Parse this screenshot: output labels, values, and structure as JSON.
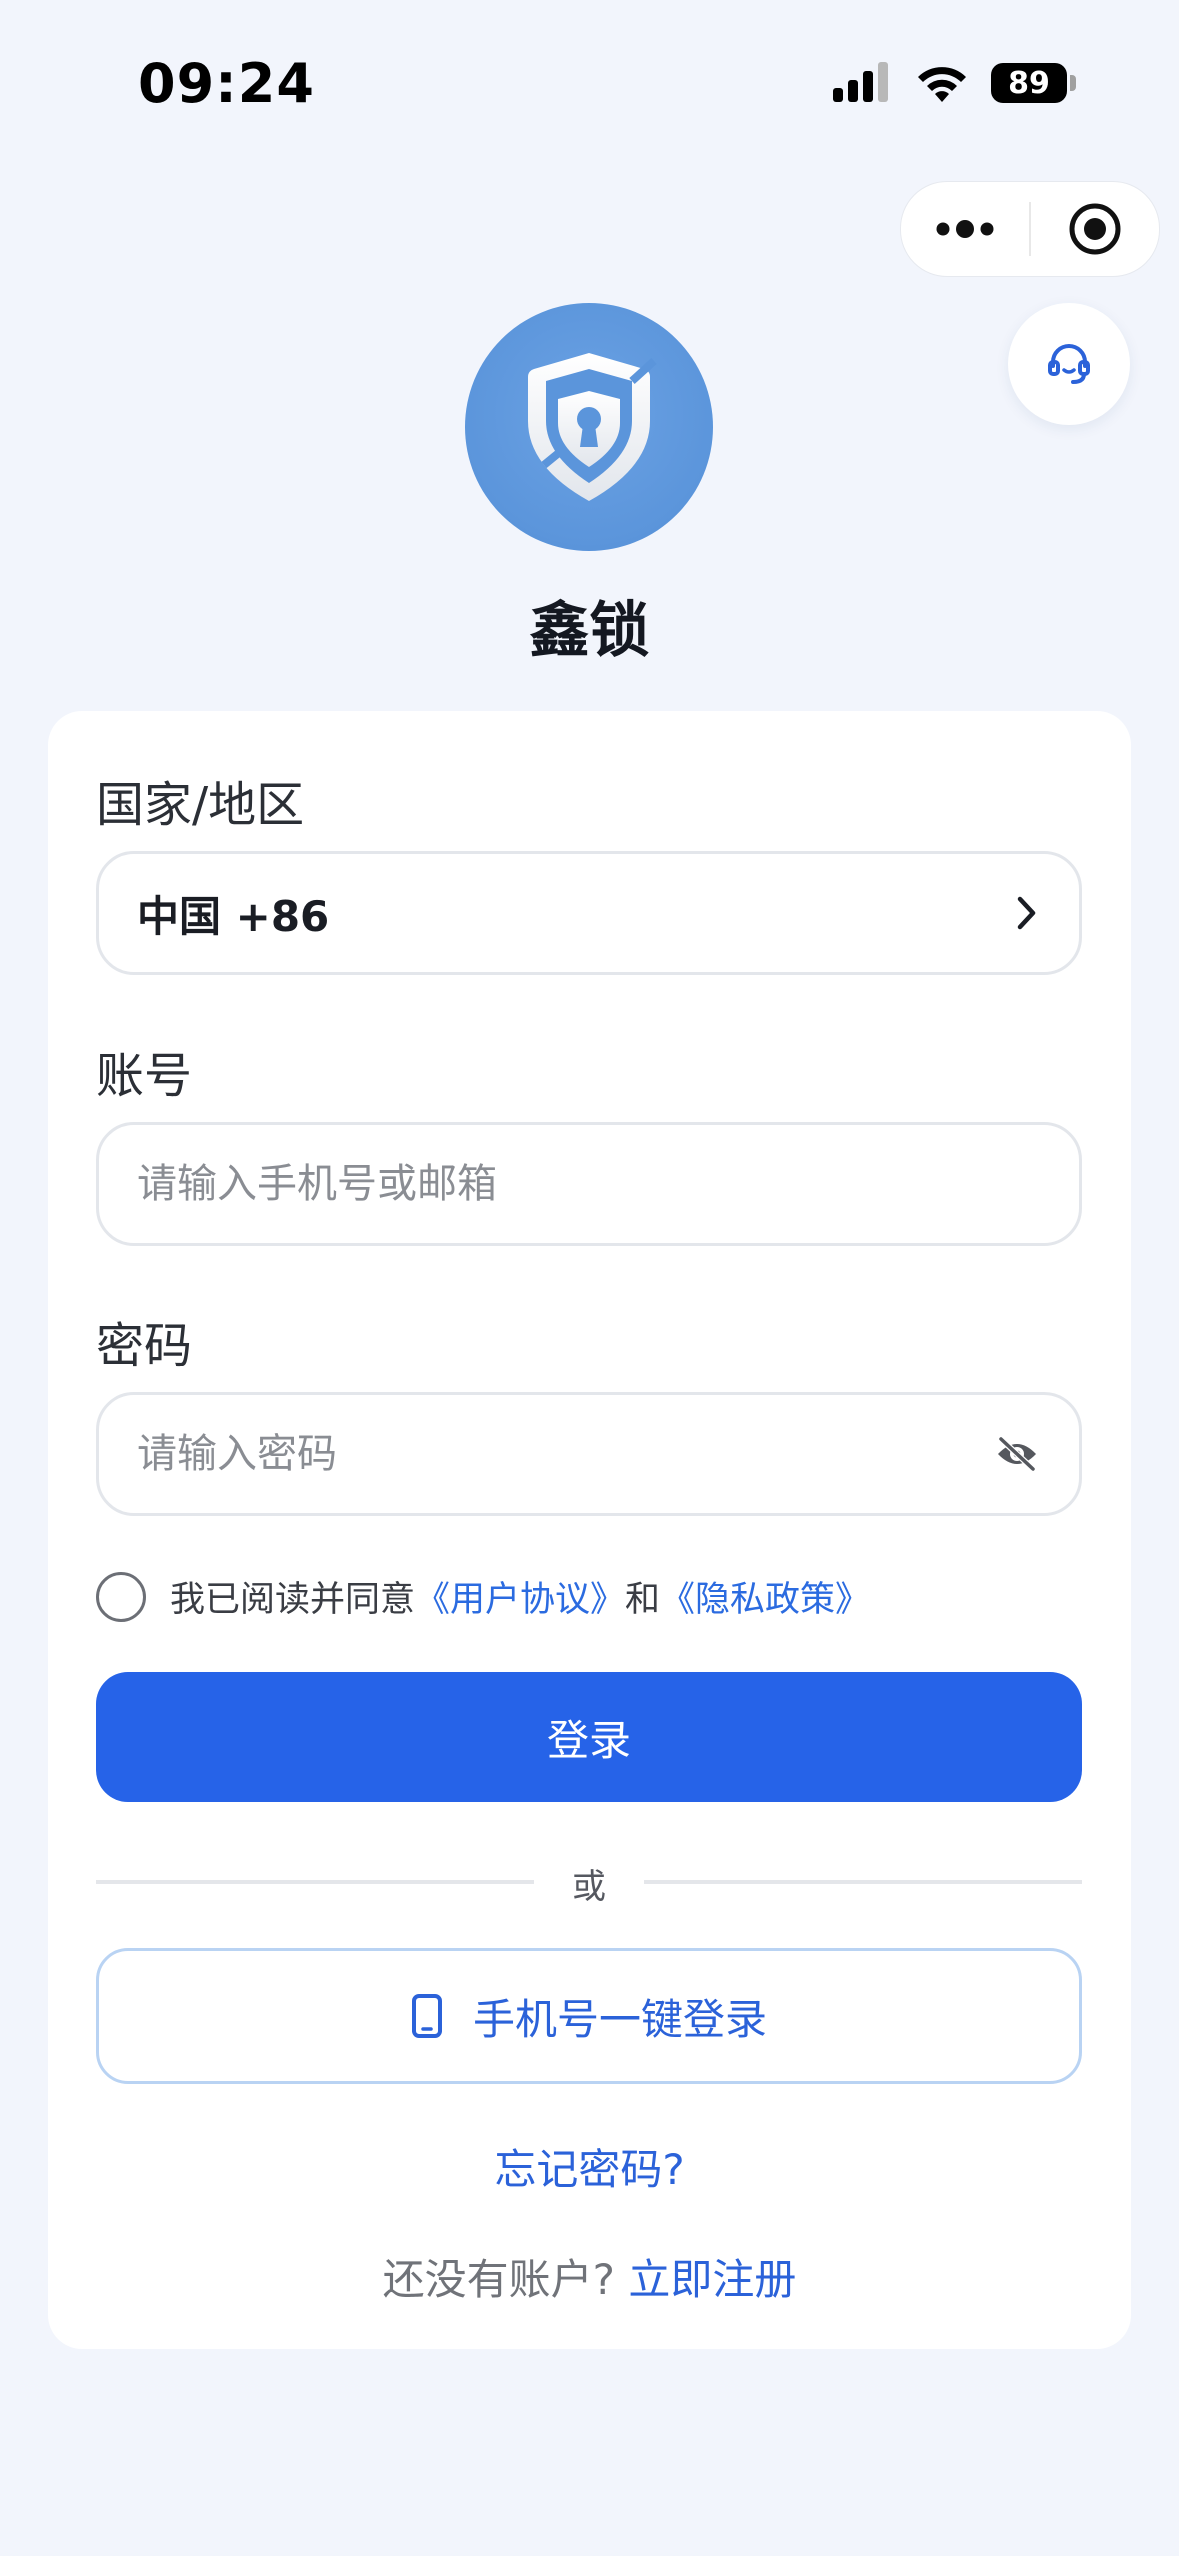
{
  "status_bar": {
    "time": "09:24",
    "battery": "89"
  },
  "icons": {
    "capsule_menu": "more-dots-icon",
    "capsule_close": "target-close-icon",
    "support": "headset-icon",
    "logo": "shield-keyhole-icon",
    "country_arrow": "chevron-right-icon",
    "password_toggle": "eye-off-icon",
    "phone": "smartphone-icon"
  },
  "app": {
    "name": "鑫锁"
  },
  "form": {
    "country_label": "国家/地区",
    "country_value": "中国 +86",
    "account_label": "账号",
    "account_placeholder": "请输入手机号或邮箱",
    "password_label": "密码",
    "password_placeholder": "请输入密码"
  },
  "agreement": {
    "text_prefix": "我已阅读并同意",
    "user_agreement": "《用户协议》",
    "text_and": "和",
    "privacy_policy": "《隐私政策》"
  },
  "actions": {
    "login": "登录",
    "divider_text": "或",
    "phone_login": "手机号一键登录",
    "forgot_password": "忘记密码?",
    "no_account": "还没有账户?",
    "register": "立即注册"
  },
  "colors": {
    "primary": "#2663E8",
    "link": "#2B62D9",
    "background": "#F2F5FC",
    "logo": "#5B95DB"
  }
}
